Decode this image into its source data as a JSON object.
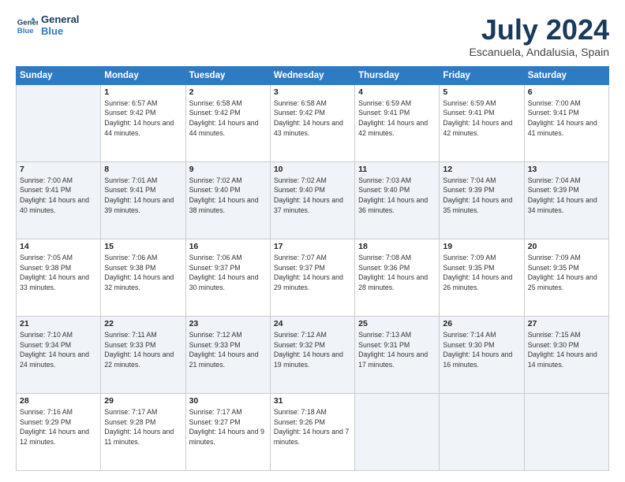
{
  "logo": {
    "line1": "General",
    "line2": "Blue"
  },
  "title": "July 2024",
  "location": "Escanuela, Andalusia, Spain",
  "headers": [
    "Sunday",
    "Monday",
    "Tuesday",
    "Wednesday",
    "Thursday",
    "Friday",
    "Saturday"
  ],
  "weeks": [
    [
      {
        "day": "",
        "sunrise": "",
        "sunset": "",
        "daylight": ""
      },
      {
        "day": "1",
        "sunrise": "Sunrise: 6:57 AM",
        "sunset": "Sunset: 9:42 PM",
        "daylight": "Daylight: 14 hours and 44 minutes."
      },
      {
        "day": "2",
        "sunrise": "Sunrise: 6:58 AM",
        "sunset": "Sunset: 9:42 PM",
        "daylight": "Daylight: 14 hours and 44 minutes."
      },
      {
        "day": "3",
        "sunrise": "Sunrise: 6:58 AM",
        "sunset": "Sunset: 9:42 PM",
        "daylight": "Daylight: 14 hours and 43 minutes."
      },
      {
        "day": "4",
        "sunrise": "Sunrise: 6:59 AM",
        "sunset": "Sunset: 9:41 PM",
        "daylight": "Daylight: 14 hours and 42 minutes."
      },
      {
        "day": "5",
        "sunrise": "Sunrise: 6:59 AM",
        "sunset": "Sunset: 9:41 PM",
        "daylight": "Daylight: 14 hours and 42 minutes."
      },
      {
        "day": "6",
        "sunrise": "Sunrise: 7:00 AM",
        "sunset": "Sunset: 9:41 PM",
        "daylight": "Daylight: 14 hours and 41 minutes."
      }
    ],
    [
      {
        "day": "7",
        "sunrise": "Sunrise: 7:00 AM",
        "sunset": "Sunset: 9:41 PM",
        "daylight": "Daylight: 14 hours and 40 minutes."
      },
      {
        "day": "8",
        "sunrise": "Sunrise: 7:01 AM",
        "sunset": "Sunset: 9:41 PM",
        "daylight": "Daylight: 14 hours and 39 minutes."
      },
      {
        "day": "9",
        "sunrise": "Sunrise: 7:02 AM",
        "sunset": "Sunset: 9:40 PM",
        "daylight": "Daylight: 14 hours and 38 minutes."
      },
      {
        "day": "10",
        "sunrise": "Sunrise: 7:02 AM",
        "sunset": "Sunset: 9:40 PM",
        "daylight": "Daylight: 14 hours and 37 minutes."
      },
      {
        "day": "11",
        "sunrise": "Sunrise: 7:03 AM",
        "sunset": "Sunset: 9:40 PM",
        "daylight": "Daylight: 14 hours and 36 minutes."
      },
      {
        "day": "12",
        "sunrise": "Sunrise: 7:04 AM",
        "sunset": "Sunset: 9:39 PM",
        "daylight": "Daylight: 14 hours and 35 minutes."
      },
      {
        "day": "13",
        "sunrise": "Sunrise: 7:04 AM",
        "sunset": "Sunset: 9:39 PM",
        "daylight": "Daylight: 14 hours and 34 minutes."
      }
    ],
    [
      {
        "day": "14",
        "sunrise": "Sunrise: 7:05 AM",
        "sunset": "Sunset: 9:38 PM",
        "daylight": "Daylight: 14 hours and 33 minutes."
      },
      {
        "day": "15",
        "sunrise": "Sunrise: 7:06 AM",
        "sunset": "Sunset: 9:38 PM",
        "daylight": "Daylight: 14 hours and 32 minutes."
      },
      {
        "day": "16",
        "sunrise": "Sunrise: 7:06 AM",
        "sunset": "Sunset: 9:37 PM",
        "daylight": "Daylight: 14 hours and 30 minutes."
      },
      {
        "day": "17",
        "sunrise": "Sunrise: 7:07 AM",
        "sunset": "Sunset: 9:37 PM",
        "daylight": "Daylight: 14 hours and 29 minutes."
      },
      {
        "day": "18",
        "sunrise": "Sunrise: 7:08 AM",
        "sunset": "Sunset: 9:36 PM",
        "daylight": "Daylight: 14 hours and 28 minutes."
      },
      {
        "day": "19",
        "sunrise": "Sunrise: 7:09 AM",
        "sunset": "Sunset: 9:35 PM",
        "daylight": "Daylight: 14 hours and 26 minutes."
      },
      {
        "day": "20",
        "sunrise": "Sunrise: 7:09 AM",
        "sunset": "Sunset: 9:35 PM",
        "daylight": "Daylight: 14 hours and 25 minutes."
      }
    ],
    [
      {
        "day": "21",
        "sunrise": "Sunrise: 7:10 AM",
        "sunset": "Sunset: 9:34 PM",
        "daylight": "Daylight: 14 hours and 24 minutes."
      },
      {
        "day": "22",
        "sunrise": "Sunrise: 7:11 AM",
        "sunset": "Sunset: 9:33 PM",
        "daylight": "Daylight: 14 hours and 22 minutes."
      },
      {
        "day": "23",
        "sunrise": "Sunrise: 7:12 AM",
        "sunset": "Sunset: 9:33 PM",
        "daylight": "Daylight: 14 hours and 21 minutes."
      },
      {
        "day": "24",
        "sunrise": "Sunrise: 7:12 AM",
        "sunset": "Sunset: 9:32 PM",
        "daylight": "Daylight: 14 hours and 19 minutes."
      },
      {
        "day": "25",
        "sunrise": "Sunrise: 7:13 AM",
        "sunset": "Sunset: 9:31 PM",
        "daylight": "Daylight: 14 hours and 17 minutes."
      },
      {
        "day": "26",
        "sunrise": "Sunrise: 7:14 AM",
        "sunset": "Sunset: 9:30 PM",
        "daylight": "Daylight: 14 hours and 16 minutes."
      },
      {
        "day": "27",
        "sunrise": "Sunrise: 7:15 AM",
        "sunset": "Sunset: 9:30 PM",
        "daylight": "Daylight: 14 hours and 14 minutes."
      }
    ],
    [
      {
        "day": "28",
        "sunrise": "Sunrise: 7:16 AM",
        "sunset": "Sunset: 9:29 PM",
        "daylight": "Daylight: 14 hours and 12 minutes."
      },
      {
        "day": "29",
        "sunrise": "Sunrise: 7:17 AM",
        "sunset": "Sunset: 9:28 PM",
        "daylight": "Daylight: 14 hours and 11 minutes."
      },
      {
        "day": "30",
        "sunrise": "Sunrise: 7:17 AM",
        "sunset": "Sunset: 9:27 PM",
        "daylight": "Daylight: 14 hours and 9 minutes."
      },
      {
        "day": "31",
        "sunrise": "Sunrise: 7:18 AM",
        "sunset": "Sunset: 9:26 PM",
        "daylight": "Daylight: 14 hours and 7 minutes."
      },
      {
        "day": "",
        "sunrise": "",
        "sunset": "",
        "daylight": ""
      },
      {
        "day": "",
        "sunrise": "",
        "sunset": "",
        "daylight": ""
      },
      {
        "day": "",
        "sunrise": "",
        "sunset": "",
        "daylight": ""
      }
    ]
  ]
}
